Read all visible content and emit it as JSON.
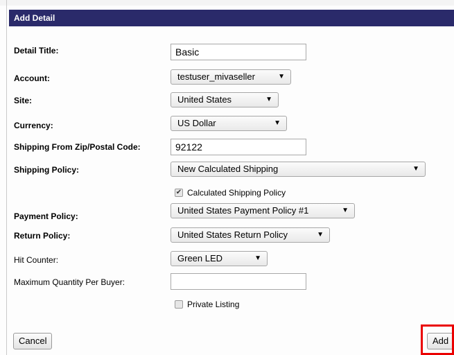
{
  "form": {
    "header": "Add Detail",
    "fields": {
      "detail_title": {
        "label": "Detail Title:",
        "value": "Basic"
      },
      "account": {
        "label": "Account:",
        "value": "testuser_mivaseller"
      },
      "site": {
        "label": "Site:",
        "value": "United States"
      },
      "currency": {
        "label": "Currency:",
        "value": "US Dollar"
      },
      "zip": {
        "label": "Shipping From Zip/Postal Code:",
        "value": "92122"
      },
      "shipping_policy": {
        "label": "Shipping Policy:",
        "value": "New Calculated Shipping"
      },
      "calculated_shipping": {
        "label": "Calculated Shipping Policy",
        "checked": true
      },
      "payment_policy": {
        "label": "Payment Policy:",
        "value": "United States Payment Policy #1"
      },
      "return_policy": {
        "label": "Return Policy:",
        "value": "United States Return Policy"
      },
      "hit_counter": {
        "label": "Hit Counter:",
        "value": "Green LED"
      },
      "max_quantity": {
        "label": "Maximum Quantity Per Buyer:",
        "value": ""
      },
      "private_listing": {
        "label": "Private Listing",
        "checked": false
      }
    },
    "buttons": {
      "cancel": "Cancel",
      "add": "Add"
    },
    "icons": {
      "dropdown": "chevron-down-icon",
      "check": "checkmark-icon"
    },
    "colors": {
      "header_bg": "#2a2a6a",
      "highlight": "#ea0000"
    }
  }
}
